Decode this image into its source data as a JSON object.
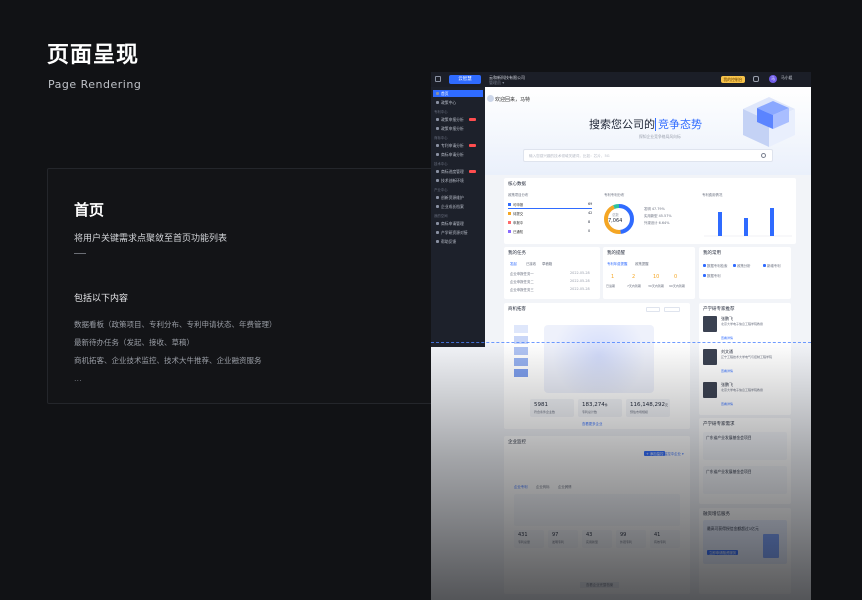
{
  "page": {
    "title": "页面呈现",
    "subtitle": "Page Rendering"
  },
  "card": {
    "title": "首页",
    "desc": "将用户关键需求点聚敛至首页功能列表",
    "dash": "——",
    "includes": "包括以下内容",
    "items": [
      "数据看板（政策项目、专利分布、专利申请状态、年费管理）",
      "最新待办任务（发起、接收、草稿）",
      "商机拓客、企业技术监控、技术大牛推荐、企业融资服务"
    ],
    "more": "..."
  },
  "app": {
    "logo": "云智慧",
    "company": "云和新科技有限公司",
    "company_sub": "管理员 ▾",
    "my_button": "我的控制台",
    "user_initial": "马",
    "user_name": "马小姐",
    "sidebar": {
      "items": [
        {
          "label": "首页",
          "active": true
        },
        {
          "label": "政策中心"
        },
        {
          "label": "政策申报分析"
        },
        {
          "label": "政策申报分析"
        },
        {
          "label": "专利申请分析"
        },
        {
          "label": "商标申请分析"
        },
        {
          "label": "商标进度管理"
        },
        {
          "label": "技术创新环境"
        },
        {
          "label": "创新资源维护"
        },
        {
          "label": "企业成长档案"
        },
        {
          "label": "商标申请管理"
        },
        {
          "label": "产学研资源对接"
        },
        {
          "label": "帮助反馈"
        }
      ],
      "sections": [
        "专利中心",
        "商标中心",
        "技术中心",
        "产业中心",
        "我的空间"
      ]
    },
    "banner": {
      "welcome": "欢迎回来，马特",
      "title_prefix": "搜索您公司的",
      "title_highlight": "竞争态势",
      "sub": "探知企业竞争格局风向标",
      "search_placeholder": "输入您感兴趣的技术领域关键词，比如：芯片、5G"
    },
    "panels": {
      "core_title": "核心数据",
      "policy_title": "政策项目分布",
      "policy_rows": [
        {
          "label": "可申报",
          "value": "69"
        },
        {
          "label": "待提交",
          "value": "42"
        },
        {
          "label": "申报中",
          "value": "8"
        },
        {
          "label": "已通知",
          "value": "0"
        }
      ],
      "patent_title": "专利专利分布",
      "patent_total": "7,064",
      "patent_total_label": "总数",
      "patent_legend": [
        "发明 47.79%",
        "实用新型 45.57%",
        "外观设计 6.64%"
      ],
      "fee_title": "专利费用情况",
      "task_title": "我的任务",
      "task_tabs": [
        "发起",
        "已接收",
        "草稿箱"
      ],
      "task_rows": [
        "企业申报任务一",
        "企业申报任务二",
        "企业申报任务三"
      ],
      "task_dates": [
        "2022-05-28",
        "2022-05-28",
        "2022-05-28"
      ],
      "remind_title": "我的提醒",
      "remind_tabs": [
        "专利年费提醒",
        "政策提醒"
      ],
      "remind_nums": [
        "1",
        "2",
        "10",
        "0"
      ],
      "remind_labels": [
        "已逾期",
        "7天内到期",
        "30天内到期",
        "90天内到期"
      ],
      "apps_title": "我的常用",
      "apps": [
        "数据专利检索",
        "政策分析",
        "新增专利",
        "数据专利"
      ],
      "biz_title": "商机拓客",
      "biz_stats": [
        {
          "value": "5981",
          "label": "符合条件企业数"
        },
        {
          "value": "183,274",
          "unit": "件",
          "label": "专利总计数"
        },
        {
          "value": "116,148,292",
          "unit": "元",
          "label": "预估市场规模"
        }
      ],
      "biz_more": "查看更多企业",
      "expert_title": "产学研专家推荐",
      "experts": [
        {
          "name": "张鹏飞",
          "desc": "北京大学电子信息工程学院教授"
        },
        {
          "name": "刘文通",
          "desc": "辽宁工程技术大学电气与控制工程学院"
        },
        {
          "name": "张鹏飞",
          "desc": "北京大学电子信息工程学院教授"
        }
      ],
      "expert_btn": "查看详情",
      "need_title": "产学研专家需求",
      "needs": [
        "广东省产业发展基金会项目",
        "广东省产业发展基金会项目"
      ],
      "monitor_title": "企业监控",
      "monitor_btn": "+ 添加监控",
      "monitor_all": "监控中企业 ▾",
      "monitor_tabs": [
        "企业专利",
        "企业商标",
        "企业舆情"
      ],
      "monitor_stats": [
        {
          "value": "431",
          "label": "专利总量"
        },
        {
          "value": "97",
          "label": "发明专利"
        },
        {
          "value": "43",
          "label": "实用新型"
        },
        {
          "value": "99",
          "label": "外观专利"
        },
        {
          "value": "41",
          "label": "有效专利"
        }
      ],
      "monitor_more": "查看企业完整档案",
      "fin_title": "融资增信服务",
      "fin_line": "最高可获得授信金额超过1亿元",
      "fin_btn": "立即申请融资服务"
    }
  }
}
